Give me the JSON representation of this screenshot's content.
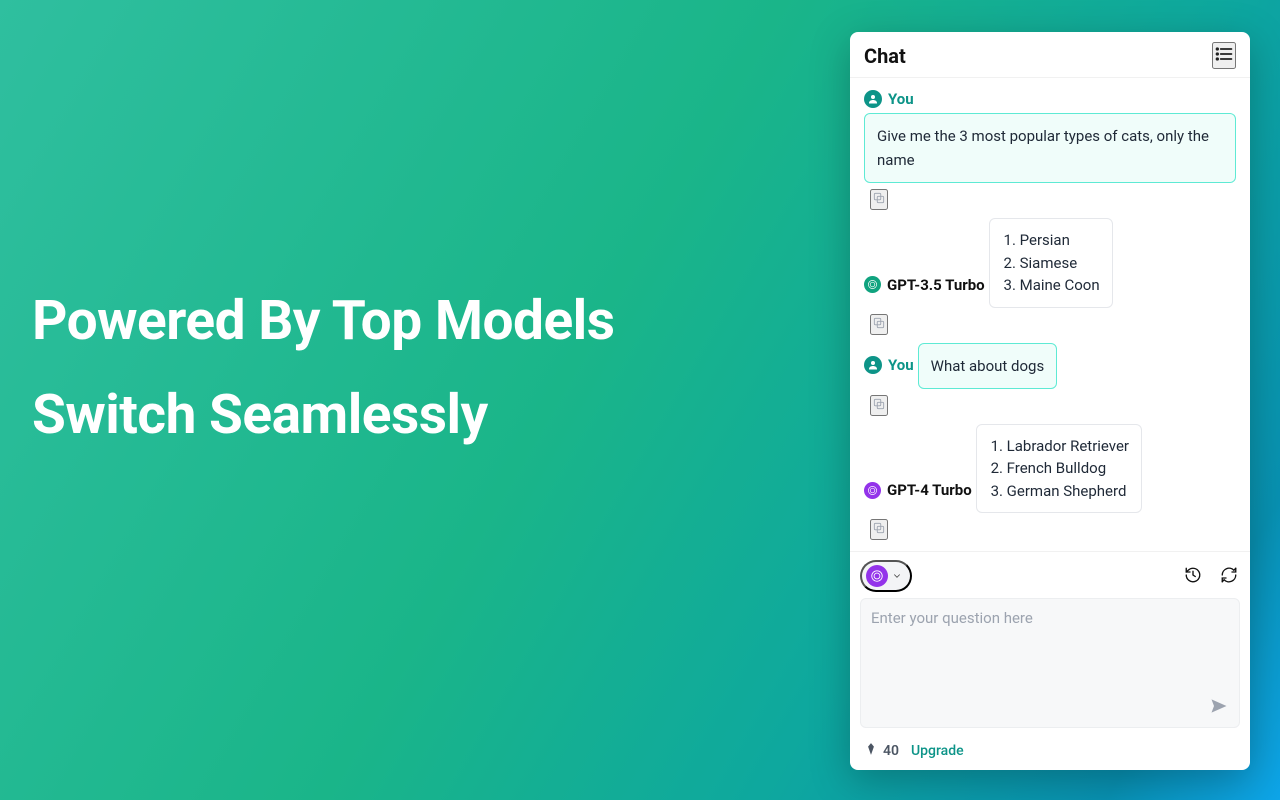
{
  "hero": {
    "line1": "Powered By Top Models",
    "line2": "Switch Seamlessly"
  },
  "chat": {
    "title": "Chat",
    "messages": [
      {
        "role": "user",
        "sender": "You",
        "text": "Give me the 3 most popular types of cats, only the name"
      },
      {
        "role": "assistant",
        "sender": "GPT-3.5 Turbo",
        "model_color": "green",
        "items": [
          "Persian",
          "Siamese",
          "Maine Coon"
        ]
      },
      {
        "role": "user",
        "sender": "You",
        "text": "What about dogs"
      },
      {
        "role": "assistant",
        "sender": "GPT-4 Turbo",
        "model_color": "purple",
        "items": [
          "Labrador Retriever",
          "French Bulldog",
          "German Shepherd"
        ]
      }
    ],
    "composer": {
      "placeholder": "Enter your question here"
    },
    "footer": {
      "credits": "40",
      "upgrade": "Upgrade"
    }
  }
}
